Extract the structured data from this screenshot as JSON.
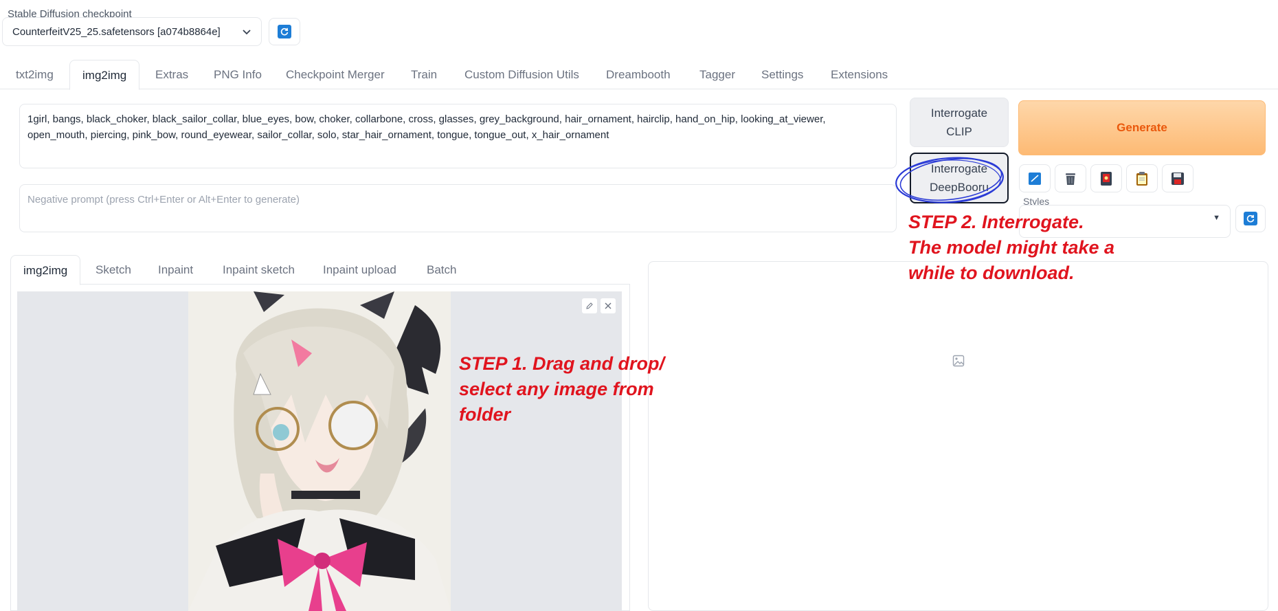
{
  "checkpoint": {
    "label": "Stable Diffusion checkpoint",
    "value": "CounterfeitV25_25.safetensors [a074b8864e]",
    "refresh_icon": "refresh-icon"
  },
  "main_tabs": [
    "txt2img",
    "img2img",
    "Extras",
    "PNG Info",
    "Checkpoint Merger",
    "Train",
    "Custom Diffusion Utils",
    "Dreambooth",
    "Tagger",
    "Settings",
    "Extensions"
  ],
  "active_main_tab": "img2img",
  "prompt": {
    "value": "1girl, bangs, black_choker, black_sailor_collar, blue_eyes, bow, choker, collarbone, cross, glasses, grey_background, hair_ornament, hairclip, hand_on_hip, looking_at_viewer, open_mouth, piercing, pink_bow, round_eyewear, sailor_collar, solo, star_hair_ornament, tongue, tongue_out, x_hair_ornament"
  },
  "negative_prompt": {
    "placeholder": "Negative prompt (press Ctrl+Enter or Alt+Enter to generate)"
  },
  "buttons": {
    "interrogate_clip": [
      "Interrogate",
      "CLIP"
    ],
    "interrogate_deepbooru": [
      "Interrogate",
      "DeepBooru"
    ],
    "generate": "Generate"
  },
  "tool_icons": [
    "checkbox-icon",
    "trash-icon",
    "red-card-icon",
    "clipboard-icon",
    "save-icon"
  ],
  "styles": {
    "label": "Styles"
  },
  "sub_tabs": [
    "img2img",
    "Sketch",
    "Inpaint",
    "Inpaint sketch",
    "Inpaint upload",
    "Batch"
  ],
  "active_sub_tab": "img2img",
  "annotations": {
    "step1": [
      "STEP 1. Drag and drop/",
      "select any image from",
      "folder"
    ],
    "step2": [
      "STEP 2. Interrogate.",
      "The model might take a",
      "while to download."
    ]
  },
  "colors": {
    "accent_orange": "#ea580c",
    "annotation_red": "#e0141e",
    "circle_blue": "#2b3bd6",
    "refresh_blue": "#1d7dd6"
  }
}
